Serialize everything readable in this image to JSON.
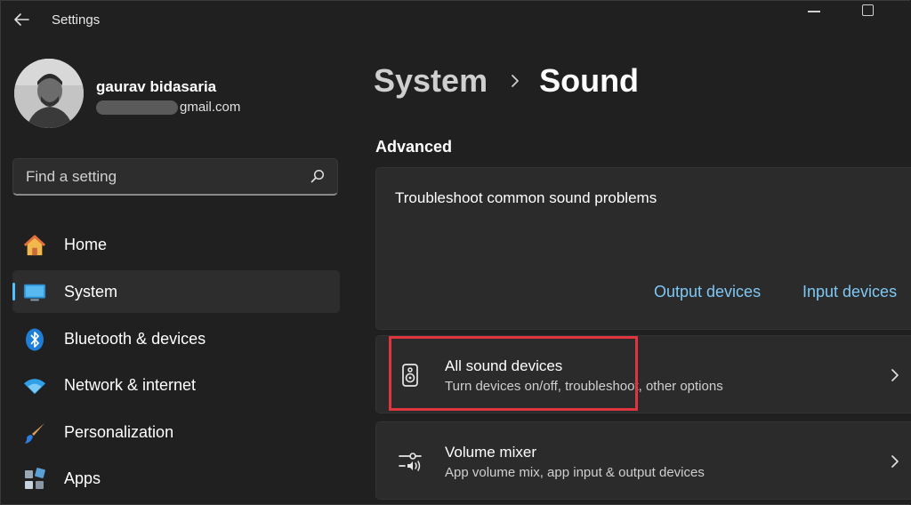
{
  "window": {
    "title": "Settings"
  },
  "profile": {
    "name": "gaurav bidasaria",
    "email": "gmail.com"
  },
  "search": {
    "placeholder": "Find a setting"
  },
  "nav": {
    "items": [
      {
        "label": "Home",
        "icon": "home-icon"
      },
      {
        "label": "System",
        "icon": "monitor-icon",
        "active": true
      },
      {
        "label": "Bluetooth & devices",
        "icon": "bluetooth-icon"
      },
      {
        "label": "Network & internet",
        "icon": "wifi-icon"
      },
      {
        "label": "Personalization",
        "icon": "paintbrush-icon"
      },
      {
        "label": "Apps",
        "icon": "apps-icon"
      }
    ]
  },
  "breadcrumb": {
    "parent": "System",
    "current": "Sound"
  },
  "section": {
    "title": "Advanced"
  },
  "troubleshoot": {
    "title": "Troubleshoot common sound problems",
    "links": [
      "Output devices",
      "Input devices"
    ]
  },
  "rows": [
    {
      "title": "All sound devices",
      "subtitle": "Turn devices on/off, troubleshoot, other options",
      "icon": "speaker-icon"
    },
    {
      "title": "Volume mixer",
      "subtitle": "App volume mix, app input & output devices",
      "icon": "mixer-icon"
    }
  ],
  "colors": {
    "accent": "#4cc2ff",
    "link": "#7ec8f5",
    "highlight": "#e0343f",
    "background": "#202020",
    "card": "#2b2b2b"
  }
}
